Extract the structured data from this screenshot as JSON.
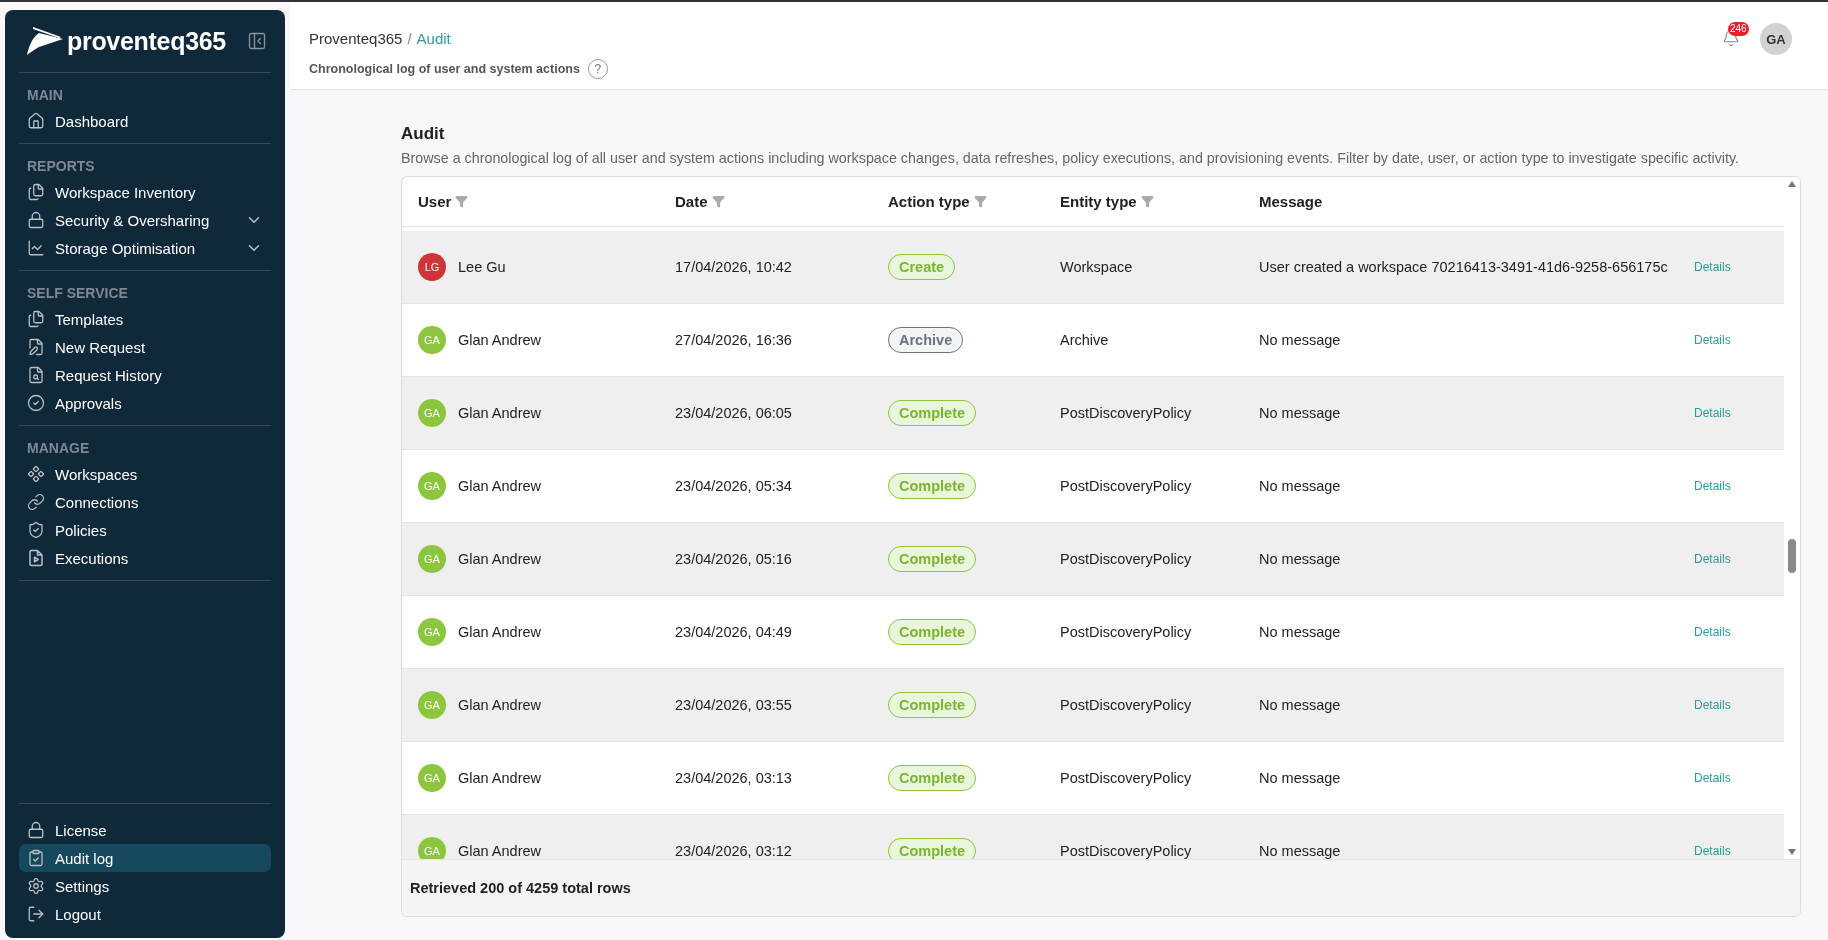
{
  "sidebar": {
    "logo": "proventeq365",
    "sections": [
      {
        "title": "MAIN",
        "items": [
          {
            "label": "Dashboard",
            "selected": false
          }
        ]
      },
      {
        "title": "REPORTS",
        "items": [
          {
            "label": "Workspace Inventory",
            "selected": false
          },
          {
            "label": "Security & Oversharing",
            "selected": false,
            "expanded": false
          },
          {
            "label": "Storage Optimisation",
            "selected": false,
            "expanded": false
          }
        ]
      },
      {
        "title": "SELF SERVICE",
        "items": [
          {
            "label": "Templates",
            "selected": false
          },
          {
            "label": "New Request",
            "selected": false
          },
          {
            "label": "Request History",
            "selected": false
          },
          {
            "label": "Approvals",
            "selected": false
          }
        ]
      },
      {
        "title": "MANAGE",
        "items": [
          {
            "label": "Workspaces",
            "selected": false
          },
          {
            "label": "Connections",
            "selected": false
          },
          {
            "label": "Policies",
            "selected": false
          },
          {
            "label": "Executions",
            "selected": false
          }
        ]
      }
    ],
    "footer_items": [
      {
        "label": "License",
        "selected": false
      },
      {
        "label": "Audit log",
        "selected": true
      },
      {
        "label": "Settings",
        "selected": false
      },
      {
        "label": "Logout",
        "selected": false
      }
    ]
  },
  "header": {
    "breadcrumb": [
      "Proventeq365",
      "/",
      "Audit"
    ],
    "subtitle": "Chronological log of user and system actions",
    "help": "?",
    "notifications": "246",
    "avatar": "GA"
  },
  "page": {
    "title": "Audit",
    "description": "Browse a chronological log of all user and system actions including workspace changes, data refreshes, policy executions, and provisioning events. Filter by date, user, or action type to investigate specific activity."
  },
  "table": {
    "columns": [
      {
        "label": "User",
        "filter": true
      },
      {
        "label": "Date",
        "filter": true
      },
      {
        "label": "Action type",
        "filter": true
      },
      {
        "label": "Entity type",
        "filter": true
      },
      {
        "label": "Message",
        "filter": false
      }
    ],
    "rows": [
      {
        "initials": "LG",
        "color": "#d13438",
        "user": "Lee Gu",
        "date": "17/04/2026, 10:42",
        "action": "Create",
        "kind": "success",
        "entity": "Workspace",
        "message": "User created a workspace 70216413-3491-41d6-9258-656175c",
        "link": "Details"
      },
      {
        "initials": "GA",
        "color": "#8cc63f",
        "user": "Glan Andrew",
        "date": "27/04/2026, 16:36",
        "action": "Archive",
        "kind": "neutral",
        "entity": "Archive",
        "message": "No message",
        "link": "Details"
      },
      {
        "initials": "GA",
        "color": "#8cc63f",
        "user": "Glan Andrew",
        "date": "23/04/2026, 06:05",
        "action": "Complete",
        "kind": "success",
        "entity": "PostDiscoveryPolicy",
        "message": "No message",
        "link": "Details"
      },
      {
        "initials": "GA",
        "color": "#8cc63f",
        "user": "Glan Andrew",
        "date": "23/04/2026, 05:34",
        "action": "Complete",
        "kind": "success",
        "entity": "PostDiscoveryPolicy",
        "message": "No message",
        "link": "Details"
      },
      {
        "initials": "GA",
        "color": "#8cc63f",
        "user": "Glan Andrew",
        "date": "23/04/2026, 05:16",
        "action": "Complete",
        "kind": "success",
        "entity": "PostDiscoveryPolicy",
        "message": "No message",
        "link": "Details"
      },
      {
        "initials": "GA",
        "color": "#8cc63f",
        "user": "Glan Andrew",
        "date": "23/04/2026, 04:49",
        "action": "Complete",
        "kind": "success",
        "entity": "PostDiscoveryPolicy",
        "message": "No message",
        "link": "Details"
      },
      {
        "initials": "GA",
        "color": "#8cc63f",
        "user": "Glan Andrew",
        "date": "23/04/2026, 03:55",
        "action": "Complete",
        "kind": "success",
        "entity": "PostDiscoveryPolicy",
        "message": "No message",
        "link": "Details"
      },
      {
        "initials": "GA",
        "color": "#8cc63f",
        "user": "Glan Andrew",
        "date": "23/04/2026, 03:13",
        "action": "Complete",
        "kind": "success",
        "entity": "PostDiscoveryPolicy",
        "message": "No message",
        "link": "Details"
      },
      {
        "initials": "GA",
        "color": "#8cc63f",
        "user": "Glan Andrew",
        "date": "23/04/2026, 03:12",
        "action": "Complete",
        "kind": "success",
        "entity": "PostDiscoveryPolicy",
        "message": "No message",
        "link": "Details"
      }
    ],
    "footer": "Retrieved 200 of 4259 total rows"
  }
}
